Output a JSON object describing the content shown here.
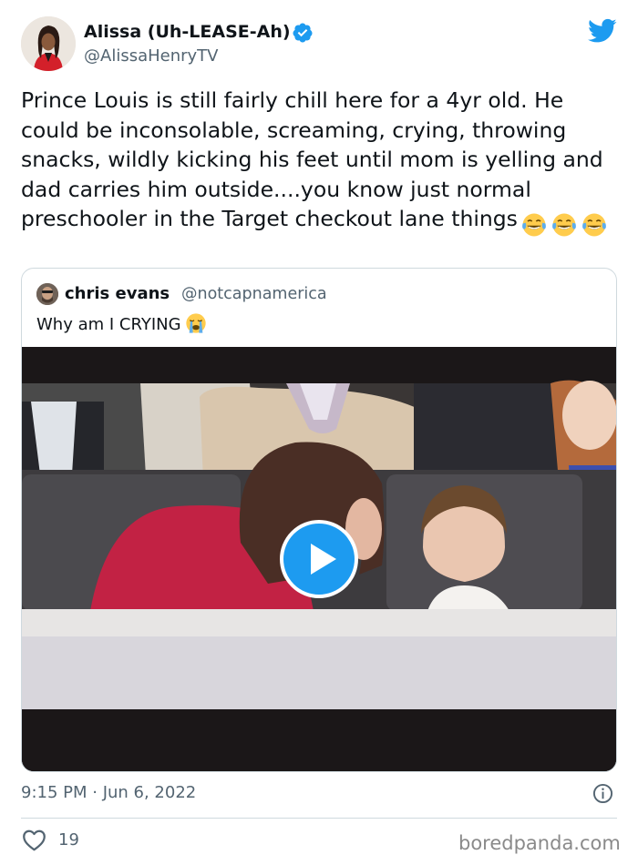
{
  "tweet": {
    "author_name": "Alissa (Uh-LEASE-Ah)",
    "author_handle": "@AlissaHenryTV",
    "text": "Prince Louis is still fairly chill here for a 4yr old. He could be inconsolable, screaming, crying, throwing snacks, wildly kicking his feet until mom is yelling and dad carries him outside....you know just normal preschooler in the Target checkout lane things",
    "text_emojis": [
      "face-with-tears-of-joy",
      "face-with-tears-of-joy",
      "face-with-tears-of-joy"
    ],
    "verified_icon": "verified-badge-icon",
    "brand_icon": "twitter-bird-icon"
  },
  "quote": {
    "author_name": "chris evans",
    "author_handle": "@notcapnamerica",
    "text": "Why am I CRYING",
    "text_emoji": "loudly-crying-face",
    "media": {
      "type": "video",
      "control_icon": "play-icon"
    }
  },
  "footer": {
    "timestamp": "9:15 PM · Jun 6, 2022",
    "info_icon": "info-icon",
    "like_icon": "heart-icon",
    "like_count": "19"
  },
  "watermark": "boredpanda.com",
  "colors": {
    "brand_blue": "#1d9bf0",
    "text_primary": "#0f1419",
    "text_secondary": "#536471",
    "border": "#cfd9de"
  }
}
